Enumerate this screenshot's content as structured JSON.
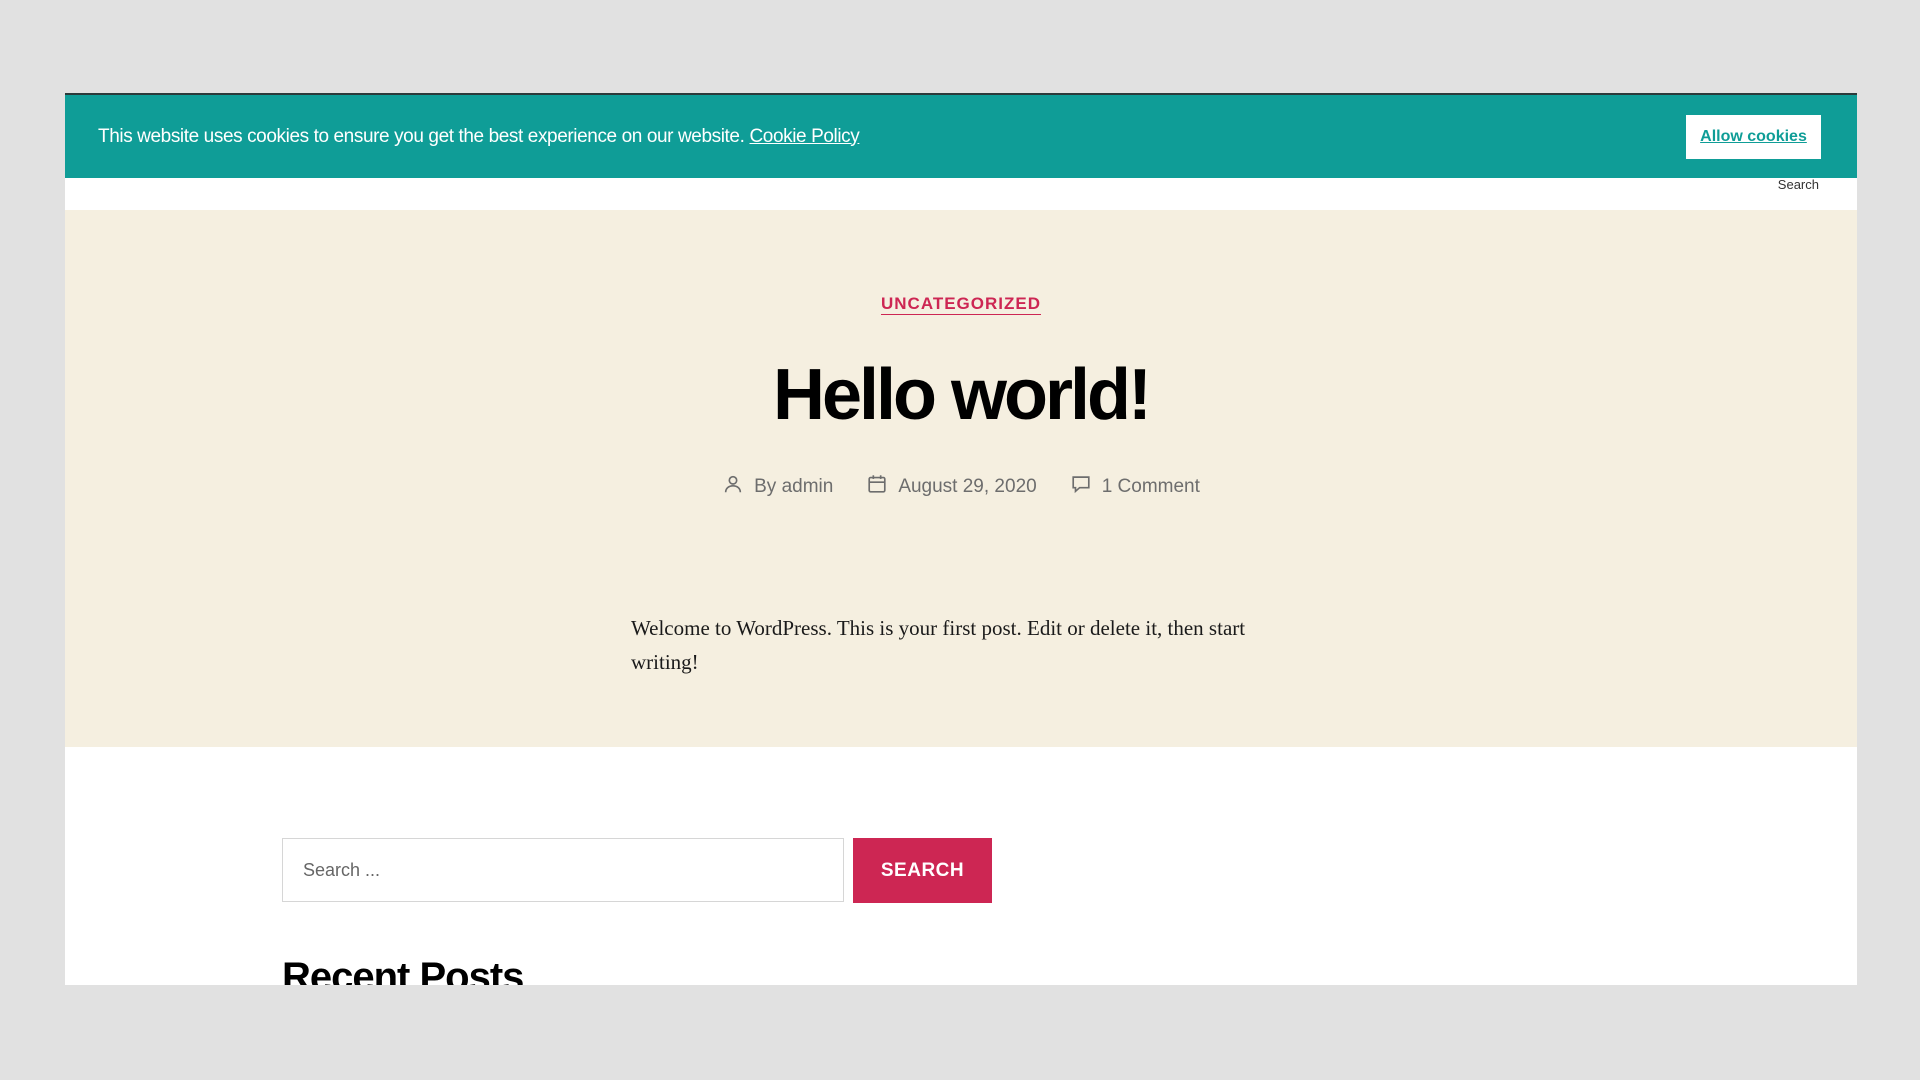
{
  "cookie_banner": {
    "message": "This website uses cookies to ensure you get the best experience on our website.",
    "policy_link": "Cookie Policy",
    "allow_button": "Allow cookies",
    "background_color": "#0f9d97"
  },
  "header": {
    "search_label": "Search"
  },
  "post": {
    "category": "UNCATEGORIZED",
    "title": "Hello world!",
    "author_prefix": "By",
    "author": "admin",
    "date": "August 29, 2020",
    "comments": "1 Comment",
    "excerpt": "Welcome to WordPress. This is your first post. Edit or delete it, then start writing!",
    "hero_background": "#f5efe0",
    "accent_color": "#cd2653",
    "icons": [
      "user-icon",
      "calendar-icon",
      "comment-icon"
    ]
  },
  "widgets": {
    "search_placeholder": "Search ...",
    "search_button": "SEARCH",
    "recent_posts_heading": "Recent Posts"
  }
}
